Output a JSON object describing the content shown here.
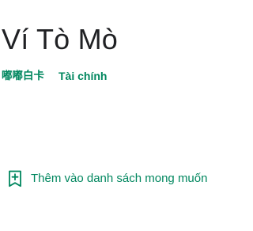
{
  "app": {
    "title": "Ví Tò Mò",
    "developer": "嘟嘟白卡",
    "category": "Tài chính"
  },
  "wishlist": {
    "label": "Thêm vào danh sách mong muốn",
    "icon": "bookmark-add-icon"
  },
  "colors": {
    "accent": "#01875f",
    "title": "#202124",
    "background": "#ffffff"
  }
}
